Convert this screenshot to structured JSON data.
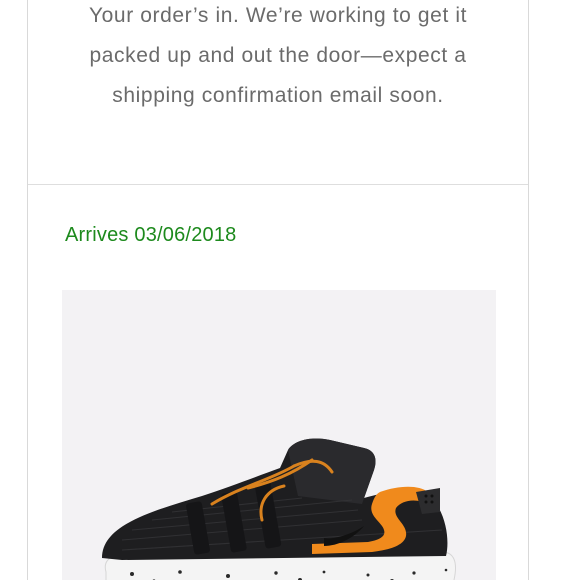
{
  "order": {
    "confirmation_lines": [
      "Your order’s in. We’re working to get it",
      "packed up and out the door—expect a",
      "shipping confirmation email soon."
    ]
  },
  "delivery": {
    "arrival_text": "Arrives 03/06/2018"
  },
  "product": {
    "image_icon": "sneaker-image",
    "colors": {
      "upper": "#1e1e20",
      "accent": "#f08a1c",
      "sole": "#f4f4f4",
      "panel_bg": "#f3f2f4"
    }
  },
  "colors": {
    "text_muted": "#6b6b6b",
    "arrival_green": "#1d8a1d",
    "border": "#d9d9d9"
  }
}
